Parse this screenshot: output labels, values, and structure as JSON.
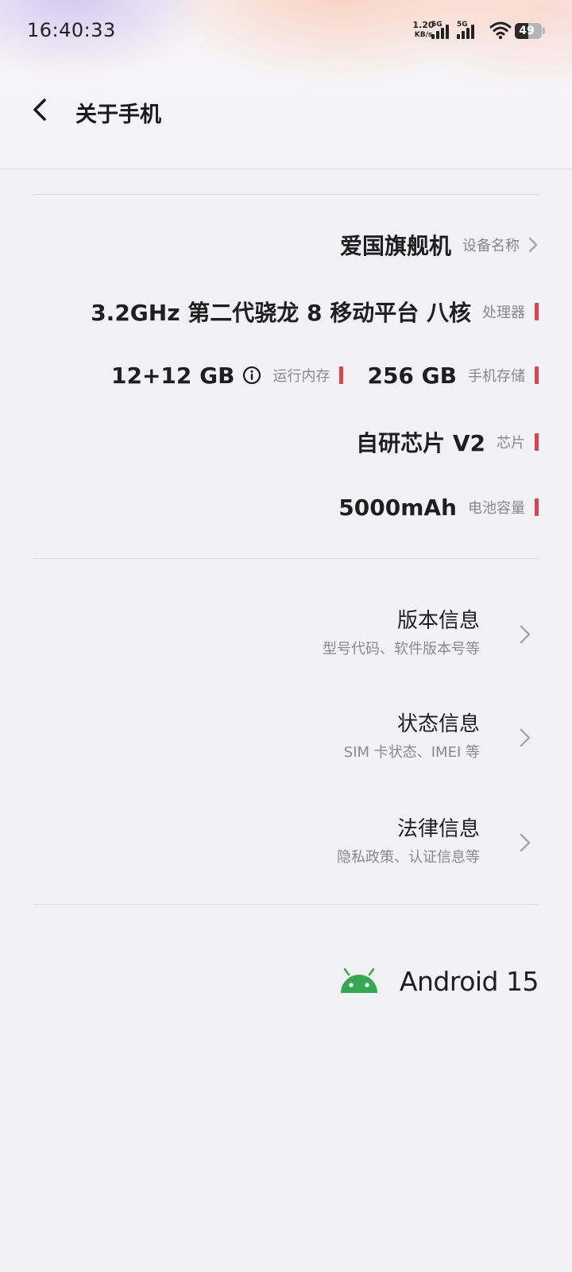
{
  "status_bar": {
    "time": "16:40:33",
    "net_speed_value": "1.20",
    "net_speed_unit": "KB/s",
    "sim1_gen": "5G",
    "sim2_gen": "5G",
    "battery_level": "49",
    "battery_fraction": 0.49
  },
  "header": {
    "title": "关于手机"
  },
  "specs": {
    "device_name": {
      "value": "爱国旗舰机",
      "label": "设备名称"
    },
    "processor": {
      "value": "3.2GHz 第二代骁龙 8 移动平台 八核",
      "label": "处理器"
    },
    "ram": {
      "value": "12+12 GB",
      "label": "运行内存"
    },
    "storage": {
      "value": "256 GB",
      "label": "手机存储"
    },
    "chip": {
      "value": "自研芯片 V2",
      "label": "芯片"
    },
    "battery": {
      "value": "5000mAh",
      "label": "电池容量"
    }
  },
  "menu": [
    {
      "title": "版本信息",
      "subtitle": "型号代码、软件版本号等"
    },
    {
      "title": "状态信息",
      "subtitle": "SIM 卡状态、IMEI 等"
    },
    {
      "title": "法律信息",
      "subtitle": "隐私政策、认证信息等"
    }
  ],
  "android": {
    "text": "Android 15"
  },
  "colors": {
    "accent_red": "#e0414b",
    "android_green": "#34a853",
    "background": "#f2f2f4"
  }
}
